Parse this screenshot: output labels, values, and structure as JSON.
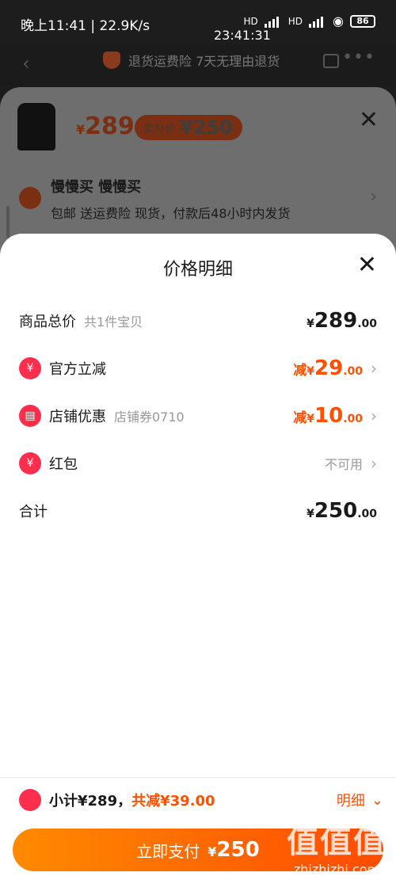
{
  "status_bar": {
    "left": "晚上11:41 | 22.9K/s",
    "clock": "23:41:31",
    "network_labels": [
      "HD",
      "HD"
    ],
    "battery": "86"
  },
  "header": {
    "notice": "退货运费险 7天无理由退货"
  },
  "product": {
    "price_symbol": "¥",
    "price": "289",
    "real_pay_label": "实付价",
    "real_pay_amount": "¥250"
  },
  "address": {
    "title": "慢慢买 慢慢买",
    "subtitle": "包邮  送运费险  现货，付款后48小时内发货"
  },
  "price_detail": {
    "title": "价格明细",
    "rows": [
      {
        "label": "商品总价",
        "sub": "共1件宝贝",
        "prefix": "",
        "currency": "¥",
        "integer": "289",
        "decimal": ".00"
      },
      {
        "label": "官方立减",
        "sub": "",
        "prefix": "减",
        "currency": "¥",
        "integer": "29",
        "decimal": ".00"
      },
      {
        "label": "店铺优惠",
        "sub": "店铺券0710",
        "prefix": "减",
        "currency": "¥",
        "integer": "10",
        "decimal": ".00"
      },
      {
        "label": "红包",
        "sub": "",
        "value": "不可用"
      },
      {
        "label": "合计",
        "sub": "",
        "prefix": "",
        "currency": "¥",
        "integer": "250",
        "decimal": ".00"
      }
    ],
    "icons": {
      "official": "¥",
      "redpacket": "¥"
    }
  },
  "summary": {
    "subtotal": "小计¥289，",
    "saving": "共减¥39.00",
    "toggle": "明细"
  },
  "pay_button": {
    "label": "立即支付",
    "currency": "¥",
    "amount": "250"
  },
  "watermark": {
    "line1": "值值值",
    "line2": "zhizhizhi.com"
  },
  "colors": {
    "accent": "#ff5000",
    "icon_red": "#ff2e4d"
  }
}
